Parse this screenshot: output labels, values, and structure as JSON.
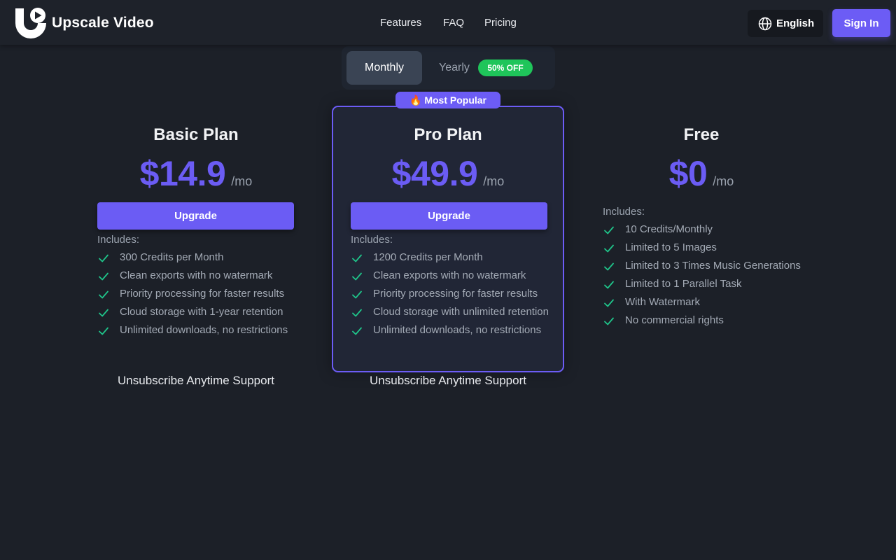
{
  "header": {
    "brand": "Upscale Video",
    "nav": [
      "Features",
      "FAQ",
      "Pricing"
    ],
    "language": "English",
    "sign_in": "Sign In"
  },
  "billing_toggle": {
    "monthly": "Monthly",
    "yearly": "Yearly",
    "discount_badge": "50% OFF",
    "selected": "Monthly"
  },
  "plans": [
    {
      "title": "Basic Plan",
      "price": "$14.9",
      "period": "/mo",
      "cta": "Upgrade",
      "includes_label": "Includes:",
      "features": [
        "300 Credits per Month",
        "Clean exports with no watermark",
        "Priority processing for faster results",
        "Cloud storage with 1-year retention",
        "Unlimited downloads, no restrictions"
      ],
      "footer": "Unsubscribe Anytime Support"
    },
    {
      "badge": "🔥 Most Popular",
      "title": "Pro Plan",
      "price": "$49.9",
      "period": "/mo",
      "cta": "Upgrade",
      "includes_label": "Includes:",
      "features": [
        "1200 Credits per Month",
        "Clean exports with no watermark",
        "Priority processing for faster results",
        "Cloud storage with unlimited retention",
        "Unlimited downloads, no restrictions"
      ],
      "footer": "Unsubscribe Anytime Support"
    },
    {
      "title": "Free",
      "price": "$0",
      "period": "/mo",
      "includes_label": "Includes:",
      "features": [
        "10 Credits/Monthly",
        "Limited to 5 Images",
        "Limited to 3 Times Music Generations",
        "Limited to 1 Parallel Task",
        "With Watermark",
        "No commercial rights"
      ]
    }
  ],
  "colors": {
    "accent": "#6b5cf4",
    "badge_green": "#1fc55a",
    "check_green": "#1fc58a",
    "background": "#1c2028"
  },
  "icons": [
    "logo-icon",
    "globe-icon",
    "check-icon"
  ]
}
